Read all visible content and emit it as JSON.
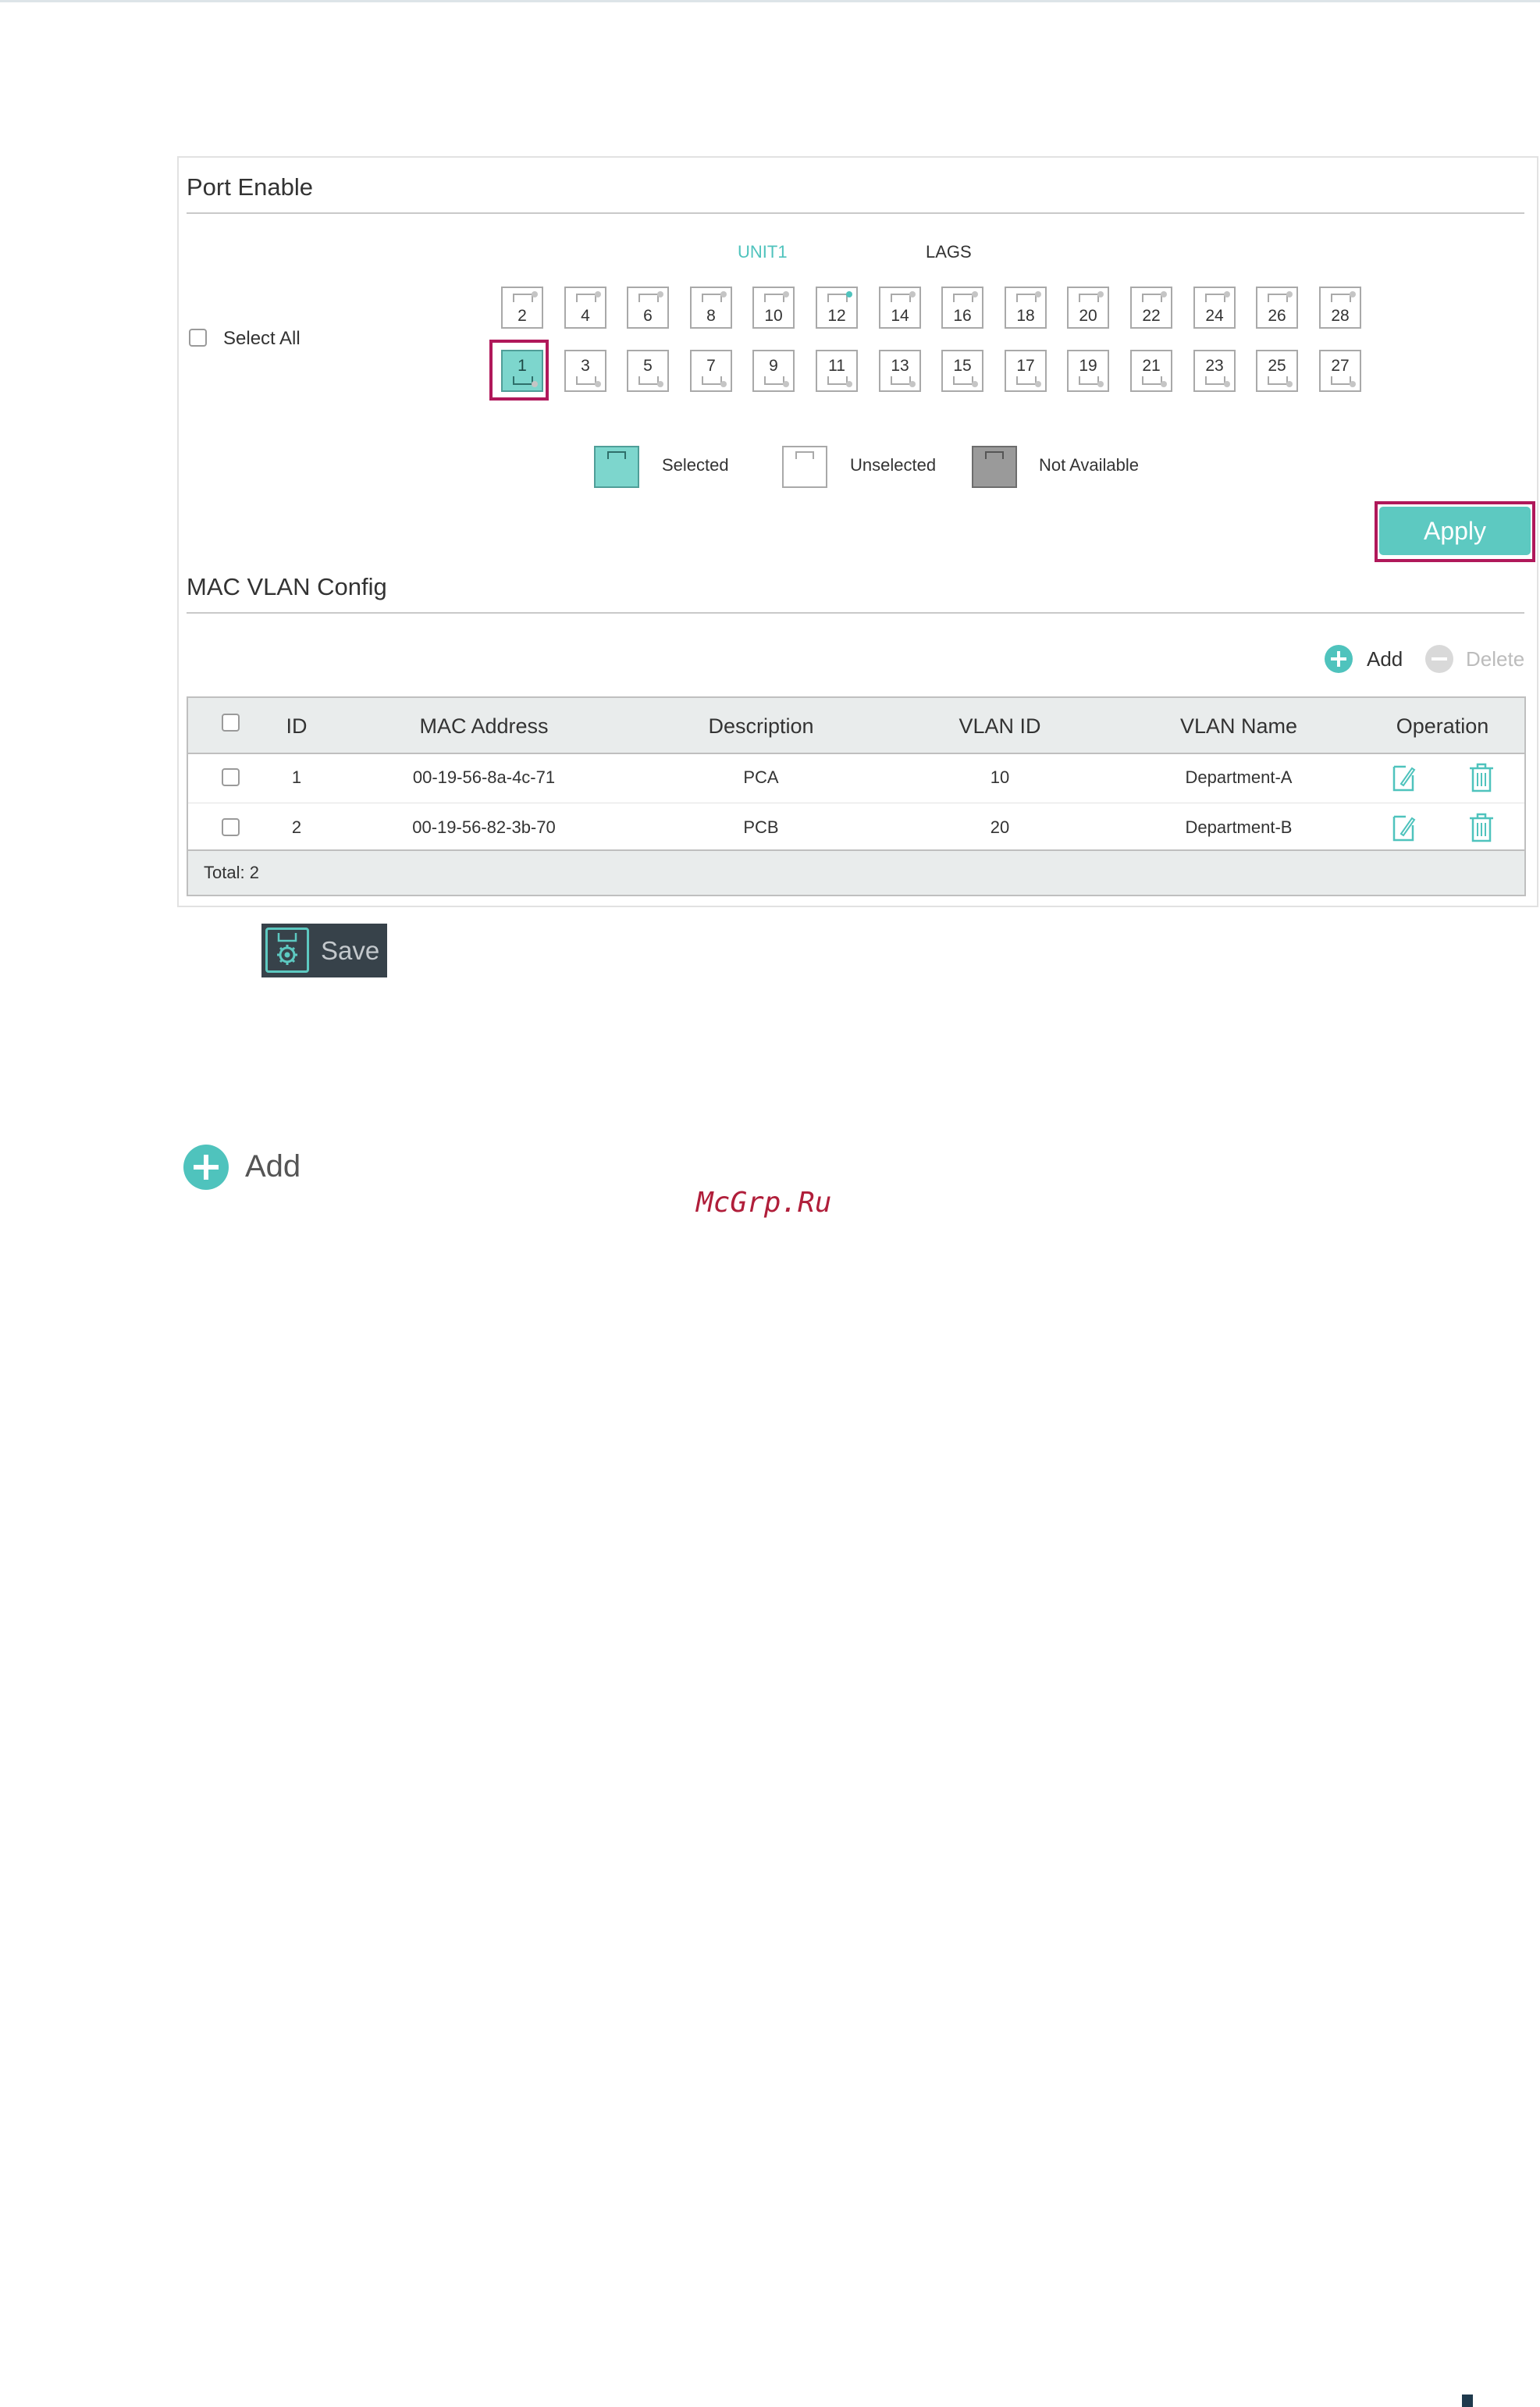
{
  "port_enable": {
    "title": "Port Enable",
    "unit_tab": "UNIT1",
    "lags_tab": "LAGS",
    "select_all": "Select All",
    "top_ports": [
      "2",
      "4",
      "6",
      "8",
      "10",
      "12",
      "14",
      "16",
      "18",
      "20",
      "22",
      "24",
      "26",
      "28"
    ],
    "bottom_ports": [
      "1",
      "3",
      "5",
      "7",
      "9",
      "11",
      "13",
      "15",
      "17",
      "19",
      "21",
      "23",
      "25",
      "27"
    ],
    "selected_port": "1",
    "active_port": "12",
    "legend": {
      "selected": "Selected",
      "unselected": "Unselected",
      "not_available": "Not Available"
    },
    "apply_label": "Apply"
  },
  "mac_vlan": {
    "title": "MAC VLAN Config",
    "add_label": "Add",
    "delete_label": "Delete",
    "columns": [
      "ID",
      "MAC Address",
      "Description",
      "VLAN ID",
      "VLAN Name",
      "Operation"
    ],
    "rows": [
      {
        "id": "1",
        "mac": "00-19-56-8a-4c-71",
        "description": "PCA",
        "vlan_id": "10",
        "vlan_name": "Department-A"
      },
      {
        "id": "2",
        "mac": "00-19-56-82-3b-70",
        "description": "PCB",
        "vlan_id": "20",
        "vlan_name": "Department-B"
      }
    ],
    "total": "Total: 2"
  },
  "save_label": "Save",
  "standalone_add_label": "Add",
  "watermark": "McGrp.Ru",
  "colors": {
    "accent": "#5dc9c1",
    "highlight": "#b0185a",
    "save_bg": "#37424a"
  }
}
